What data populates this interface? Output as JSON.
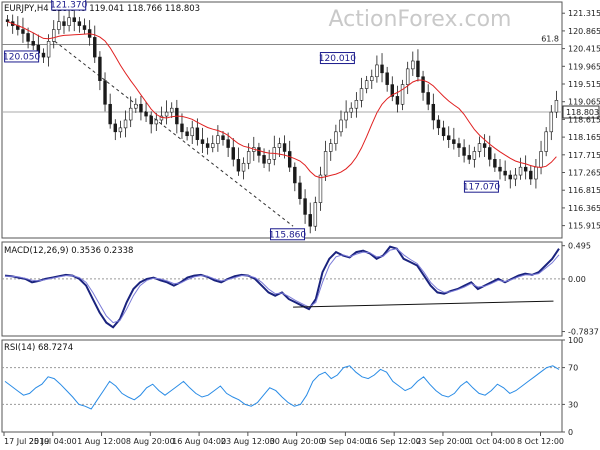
{
  "watermark": "ActionForex.com",
  "chart_data": [
    {
      "type": "candlestick",
      "header": "EURJPY,H4 118.949 119.041 118.766 118.803",
      "ylim": [
        115.6,
        121.6
      ],
      "y_ticks": [
        "121.315",
        "120.865",
        "120.415",
        "119.965",
        "119.515",
        "119.065",
        "118.615",
        "118.165",
        "117.715",
        "117.265",
        "116.815",
        "116.365",
        "115.915"
      ],
      "tick_values": [
        121.315,
        120.865,
        120.415,
        119.965,
        119.515,
        119.065,
        118.615,
        118.165,
        117.715,
        117.265,
        116.815,
        116.365,
        115.915
      ],
      "tick_labels": [
        "121.315",
        "120.865",
        "120.415",
        "119.965",
        "119.515",
        "119.065",
        "118.615",
        "118.165",
        "117.715",
        "117.265",
        "116.815",
        "116.365",
        "115.915"
      ],
      "price_label": "118.803",
      "price_value": 118.803,
      "fib_label": "61.8",
      "fib_value": 120.52,
      "ma_color": "#e02020",
      "candle_color": "#1a1a1a",
      "annotations": [
        {
          "text": "121.370",
          "value": 121.37,
          "t": 0.115
        },
        {
          "text": "120.050",
          "value": 120.05,
          "t": 0.03
        },
        {
          "text": "120.010",
          "value": 120.01,
          "t": 0.6
        },
        {
          "text": "115.860",
          "value": 115.86,
          "t": 0.51
        },
        {
          "text": "117.070",
          "value": 117.07,
          "t": 0.86
        }
      ],
      "close_series": [
        121.1,
        121.0,
        120.9,
        120.8,
        120.6,
        120.5,
        120.3,
        120.2,
        120.6,
        120.9,
        121.1,
        121.0,
        121.2,
        121.1,
        121.0,
        120.9,
        120.7,
        120.2,
        119.6,
        119.0,
        118.5,
        118.3,
        118.4,
        118.6,
        118.9,
        119.0,
        118.8,
        118.7,
        118.5,
        118.6,
        118.7,
        118.8,
        118.9,
        118.5,
        118.3,
        118.2,
        118.4,
        118.1,
        118.0,
        117.9,
        118.0,
        118.2,
        118.1,
        117.9,
        117.6,
        117.3,
        117.5,
        117.8,
        117.9,
        117.7,
        117.5,
        117.6,
        117.9,
        118.0,
        117.8,
        117.4,
        117.0,
        116.6,
        116.2,
        115.9,
        116.5,
        117.2,
        117.8,
        118.0,
        118.3,
        118.6,
        118.8,
        118.9,
        119.1,
        119.4,
        119.6,
        119.7,
        120.0,
        119.8,
        119.5,
        119.2,
        119.0,
        119.5,
        119.9,
        120.1,
        119.7,
        119.3,
        119.0,
        118.6,
        118.4,
        118.2,
        118.1,
        118.0,
        117.9,
        117.7,
        117.6,
        117.8,
        118.0,
        117.9,
        117.6,
        117.4,
        117.3,
        117.2,
        117.1,
        117.2,
        117.4,
        117.3,
        117.1,
        117.4,
        117.8,
        118.3,
        118.8,
        119.1
      ]
    },
    {
      "type": "line",
      "header": "MACD(12,26,9) 0.3536 0.2338",
      "ylim": [
        -0.85,
        0.55
      ],
      "tick_values": [
        0.495,
        0.0,
        -0.7837
      ],
      "tick_labels": [
        "0.495",
        "0.00",
        "-0.7837"
      ],
      "zero_line": 0.0,
      "series": [
        {
          "role": "macd",
          "color": "#1a237e",
          "values": [
            0.05,
            0.04,
            0.02,
            0.0,
            -0.05,
            -0.03,
            0.0,
            0.02,
            0.04,
            0.06,
            0.05,
            0.0,
            -0.1,
            -0.3,
            -0.5,
            -0.65,
            -0.72,
            -0.6,
            -0.35,
            -0.15,
            -0.05,
            0.0,
            0.02,
            -0.02,
            -0.05,
            -0.1,
            -0.05,
            0.02,
            0.05,
            0.06,
            0.03,
            -0.02,
            -0.05,
            0.0,
            0.04,
            0.06,
            0.05,
            0.0,
            -0.1,
            -0.2,
            -0.25,
            -0.2,
            -0.3,
            -0.35,
            -0.4,
            -0.45,
            -0.3,
            0.1,
            0.3,
            0.4,
            0.35,
            0.32,
            0.4,
            0.42,
            0.38,
            0.3,
            0.35,
            0.48,
            0.45,
            0.3,
            0.25,
            0.2,
            0.05,
            -0.1,
            -0.2,
            -0.22,
            -0.18,
            -0.15,
            -0.1,
            -0.05,
            -0.15,
            -0.1,
            -0.05,
            0.0,
            -0.05,
            0.0,
            0.05,
            0.08,
            0.06,
            0.1,
            0.2,
            0.3,
            0.45
          ]
        },
        {
          "role": "signal",
          "color": "#7b7bd8",
          "values": [
            0.04,
            0.04,
            0.03,
            0.01,
            -0.02,
            -0.03,
            -0.01,
            0.01,
            0.03,
            0.05,
            0.05,
            0.02,
            -0.05,
            -0.2,
            -0.38,
            -0.55,
            -0.65,
            -0.62,
            -0.45,
            -0.25,
            -0.1,
            -0.02,
            0.01,
            0.0,
            -0.03,
            -0.07,
            -0.06,
            -0.01,
            0.03,
            0.05,
            0.04,
            0.0,
            -0.03,
            -0.01,
            0.02,
            0.05,
            0.05,
            0.02,
            -0.05,
            -0.15,
            -0.22,
            -0.21,
            -0.26,
            -0.32,
            -0.37,
            -0.42,
            -0.35,
            -0.05,
            0.2,
            0.33,
            0.36,
            0.33,
            0.37,
            0.4,
            0.39,
            0.33,
            0.34,
            0.43,
            0.45,
            0.36,
            0.29,
            0.23,
            0.1,
            -0.05,
            -0.15,
            -0.2,
            -0.19,
            -0.16,
            -0.12,
            -0.07,
            -0.12,
            -0.11,
            -0.07,
            -0.02,
            -0.04,
            -0.01,
            0.03,
            0.06,
            0.06,
            0.08,
            0.16,
            0.24,
            0.36
          ]
        }
      ],
      "trendline": {
        "from": {
          "t": 0.52,
          "value": -0.42
        },
        "to": {
          "t": 0.99,
          "value": -0.33
        }
      }
    },
    {
      "type": "line",
      "header": "RSI(14) 68.7274",
      "ylim": [
        0,
        100
      ],
      "tick_values": [
        100,
        70,
        30,
        0
      ],
      "tick_labels": [
        "100",
        "70",
        "30",
        "0"
      ],
      "guides": [
        70,
        30
      ],
      "series": [
        {
          "role": "rsi",
          "color": "#2a8ce6",
          "values": [
            55,
            50,
            45,
            40,
            42,
            48,
            52,
            60,
            58,
            52,
            45,
            38,
            30,
            28,
            25,
            35,
            45,
            55,
            50,
            42,
            38,
            35,
            40,
            48,
            52,
            45,
            40,
            45,
            50,
            55,
            48,
            42,
            38,
            40,
            45,
            50,
            42,
            38,
            35,
            30,
            28,
            32,
            40,
            48,
            45,
            38,
            32,
            28,
            30,
            40,
            55,
            62,
            65,
            58,
            62,
            70,
            72,
            65,
            60,
            58,
            62,
            68,
            65,
            55,
            50,
            45,
            48,
            55,
            60,
            52,
            45,
            40,
            38,
            42,
            50,
            55,
            48,
            42,
            40,
            45,
            52,
            48,
            42,
            45,
            50,
            55,
            60,
            65,
            70,
            72,
            68
          ]
        }
      ]
    }
  ],
  "x_labels": [
    "17 Jul 2019",
    "25 Jul 04:00",
    "1 Aug 12:00",
    "8 Aug 20:00",
    "16 Aug 04:00",
    "23 Aug 12:00",
    "30 Aug 20:00",
    "9 Sep 04:00",
    "16 Sep 12:00",
    "23 Sep 20:00",
    "1 Oct 04:00",
    "8 Oct 12:00"
  ]
}
